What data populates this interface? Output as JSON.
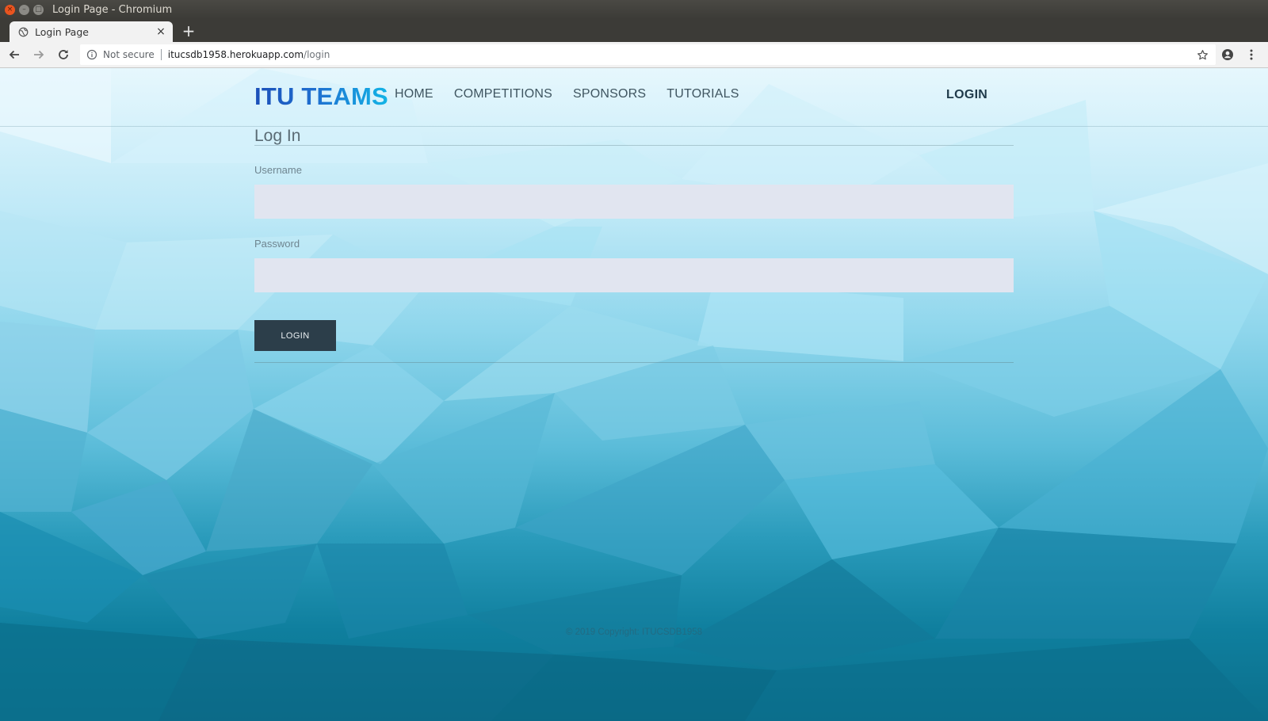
{
  "window": {
    "title": "Login Page - Chromium",
    "controls": {
      "close": "×",
      "minimize": "–",
      "maximize": "□"
    }
  },
  "browser": {
    "tab": {
      "title": "Login Page",
      "close": "×"
    },
    "new_tab": "+",
    "omnibox": {
      "security_label": "Not secure",
      "url_host": "itucsdb1958.herokuapp.com",
      "url_path": "/login"
    }
  },
  "site": {
    "brand": "ITU TEAMS",
    "nav": [
      "HOME",
      "COMPETITIONS",
      "SPONSORS",
      "TUTORIALS"
    ],
    "login_link": "LOGIN"
  },
  "form": {
    "heading": "Log In",
    "username_label": "Username",
    "username_value": "",
    "password_label": "Password",
    "password_value": "",
    "submit_label": "LOGIN"
  },
  "footer": {
    "copyright": "© 2019 Copyright: ITUCSDB1958"
  },
  "colors": {
    "button_bg": "#2c3e4a",
    "input_bg": "#e1e5f0",
    "brand_start": "#1b4fb8",
    "brand_end": "#12b4e6"
  }
}
